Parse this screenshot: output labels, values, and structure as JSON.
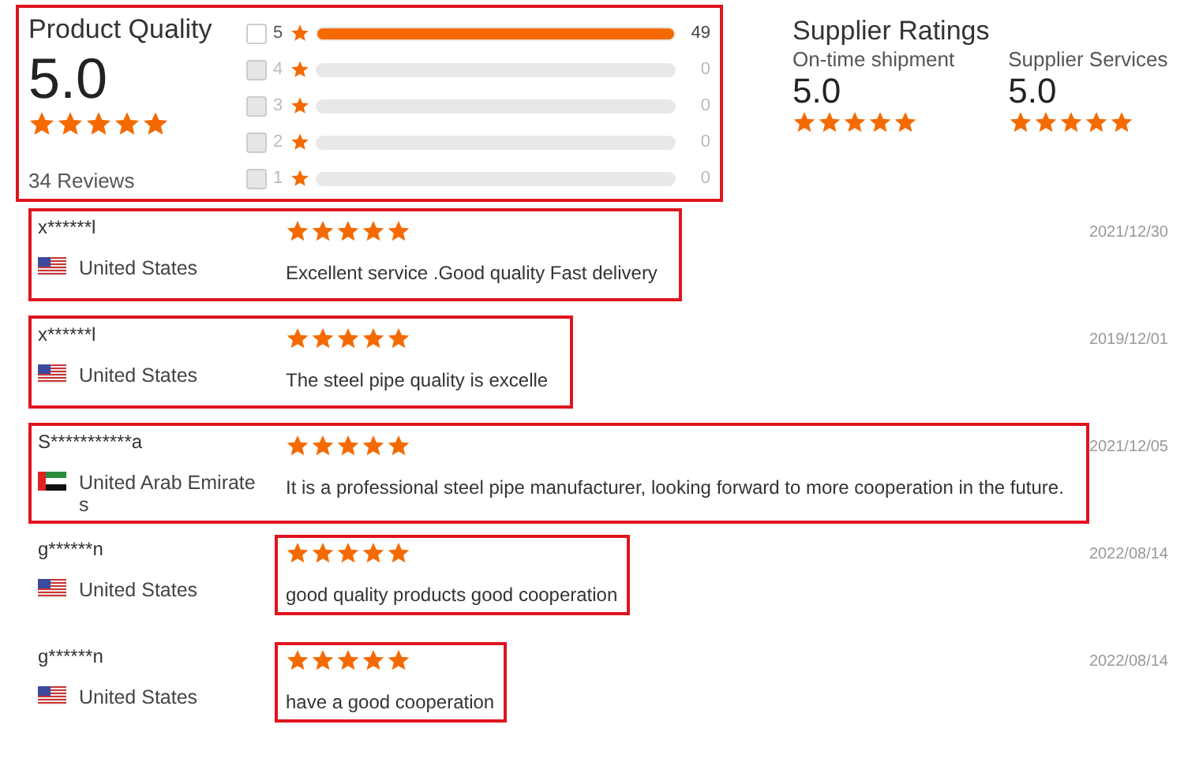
{
  "product_quality": {
    "title": "Product Quality",
    "score": "5.0",
    "stars": 5,
    "reviews": "34 Reviews",
    "highlighted": true,
    "breakdown": [
      {
        "label": "5",
        "count": "49",
        "level": 1,
        "disabled": false
      },
      {
        "label": "4",
        "count": "0",
        "disabled": true
      },
      {
        "label": "3",
        "count": "0",
        "disabled": true
      },
      {
        "label": "2",
        "count": "0",
        "disabled": true
      },
      {
        "label": "1",
        "count": "0",
        "disabled": true
      }
    ]
  },
  "supplier_ratings": {
    "title": "Supplier Ratings",
    "items": [
      {
        "label": "On-time shipment",
        "score": "5.0",
        "stars": 5
      },
      {
        "label": "Supplier Services",
        "score": "5.0",
        "stars": 5
      }
    ]
  },
  "reviews": [
    {
      "name": "x******l",
      "country": "United States",
      "kind": "us",
      "stars": 5,
      "comment": "Excellent service .Good quality Fast delivery",
      "date": "2021/12/30",
      "row_highlighted": true,
      "comment_highlighted": false
    },
    {
      "name": "x******l",
      "country": "United States",
      "kind": "us",
      "stars": 5,
      "comment": "The steel pipe quality is excelle",
      "date": "2019/12/01",
      "row_highlighted": true,
      "comment_highlighted": false
    },
    {
      "name": "S***********a",
      "country": "United Arab Emirates",
      "kind": "ae",
      "stars": 5,
      "comment": "It is a professional steel pipe manufacturer, looking forward to more cooperation in the future.",
      "date": "2021/12/05",
      "row_highlighted": true,
      "comment_highlighted": false
    },
    {
      "name": "g******n",
      "country": "United States",
      "kind": "us",
      "stars": 5,
      "comment": "good quality products good cooperation",
      "date": "2022/08/14",
      "row_highlighted": false,
      "comment_highlighted": true
    },
    {
      "name": "g******n",
      "country": "United States",
      "kind": "us",
      "stars": 5,
      "comment": "have a good cooperation",
      "date": "2022/08/14",
      "row_highlighted": false,
      "comment_highlighted": true
    }
  ]
}
